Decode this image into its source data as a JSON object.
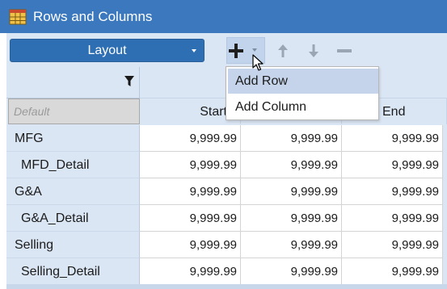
{
  "window": {
    "title": "Rows and Columns",
    "icon": "table-grid-icon"
  },
  "toolbar": {
    "layout_label": "Layout",
    "icons": [
      "plus-icon",
      "dropdown-caret-icon",
      "arrow-up-icon",
      "arrow-down-icon",
      "minus-icon"
    ]
  },
  "dropdown_menu": {
    "items": [
      {
        "label": "Add Row",
        "hovered": true
      },
      {
        "label": "Add Column",
        "hovered": false
      }
    ]
  },
  "grid": {
    "default_placeholder": "Default",
    "columns": [
      "Start",
      "",
      "End"
    ],
    "rows": [
      {
        "label": "MFG",
        "values": [
          "9,999.99",
          "9,999.99",
          "9,999.99"
        ]
      },
      {
        "label": "MFD_Detail",
        "values": [
          "9,999.99",
          "9,999.99",
          "9,999.99"
        ]
      },
      {
        "label": "G&A",
        "values": [
          "9,999.99",
          "9,999.99",
          "9,999.99"
        ]
      },
      {
        "label": "G&A_Detail",
        "values": [
          "9,999.99",
          "9,999.99",
          "9,999.99"
        ]
      },
      {
        "label": "Selling",
        "values": [
          "9,999.99",
          "9,999.99",
          "9,999.99"
        ]
      },
      {
        "label": "Selling_Detail",
        "values": [
          "9,999.99",
          "9,999.99",
          "9,999.99"
        ]
      }
    ]
  },
  "colors": {
    "title_bar": "#3b78bd",
    "layout_button": "#2e6fb4",
    "header_bg": "#dbe6f4",
    "menu_hover": "#c5d4ea"
  }
}
